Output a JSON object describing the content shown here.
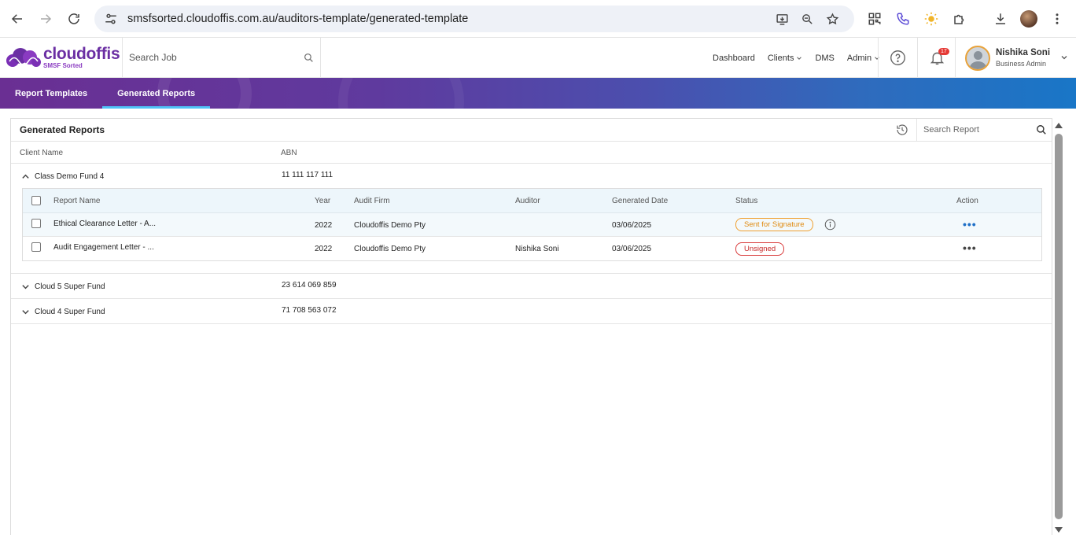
{
  "browser": {
    "url": "smsfsorted.cloudoffis.com.au/auditors-template/generated-template"
  },
  "app": {
    "brand": "cloudoffis",
    "brand_sub": "SMSF Sorted",
    "search_job_placeholder": "Search Job",
    "nav": {
      "dashboard": "Dashboard",
      "clients": "Clients",
      "dms": "DMS",
      "admin": "Admin"
    },
    "notifications_count": "17",
    "user": {
      "name": "Nishika Soni",
      "role": "Business Admin"
    }
  },
  "tabs": {
    "report_templates": "Report Templates",
    "generated_reports": "Generated Reports"
  },
  "panel": {
    "title": "Generated Reports",
    "search_placeholder": "Search Report",
    "columns": {
      "client_name": "Client Name",
      "abn": "ABN"
    },
    "sub_columns": {
      "report_name": "Report Name",
      "year": "Year",
      "audit_firm": "Audit Firm",
      "auditor": "Auditor",
      "generated_date": "Generated Date",
      "status": "Status",
      "action": "Action"
    },
    "clients": [
      {
        "name": "Class Demo Fund 4",
        "abn": "11 111 117 111",
        "expanded": true,
        "reports": [
          {
            "name": "Ethical Clearance Letter - A...",
            "year": "2022",
            "audit_firm": "Cloudoffis Demo Pty",
            "auditor": "",
            "generated_date": "03/06/2025",
            "status": "Sent for Signature"
          },
          {
            "name": "Audit Engagement Letter - ...",
            "year": "2022",
            "audit_firm": "Cloudoffis Demo Pty",
            "auditor": "Nishika Soni",
            "generated_date": "03/06/2025",
            "status": "Unsigned"
          }
        ]
      },
      {
        "name": "Cloud 5 Super Fund",
        "abn": "23 614 069 859",
        "expanded": false
      },
      {
        "name": "Cloud 4 Super Fund",
        "abn": "71 708 563 072",
        "expanded": false
      }
    ],
    "action_icon": "more-horizontal-icon"
  },
  "colors": {
    "brand_purple": "#6b2fa3",
    "status_sent": "#e08a10",
    "status_unsigned": "#c62828",
    "tab_underline": "#4fc3f7"
  }
}
